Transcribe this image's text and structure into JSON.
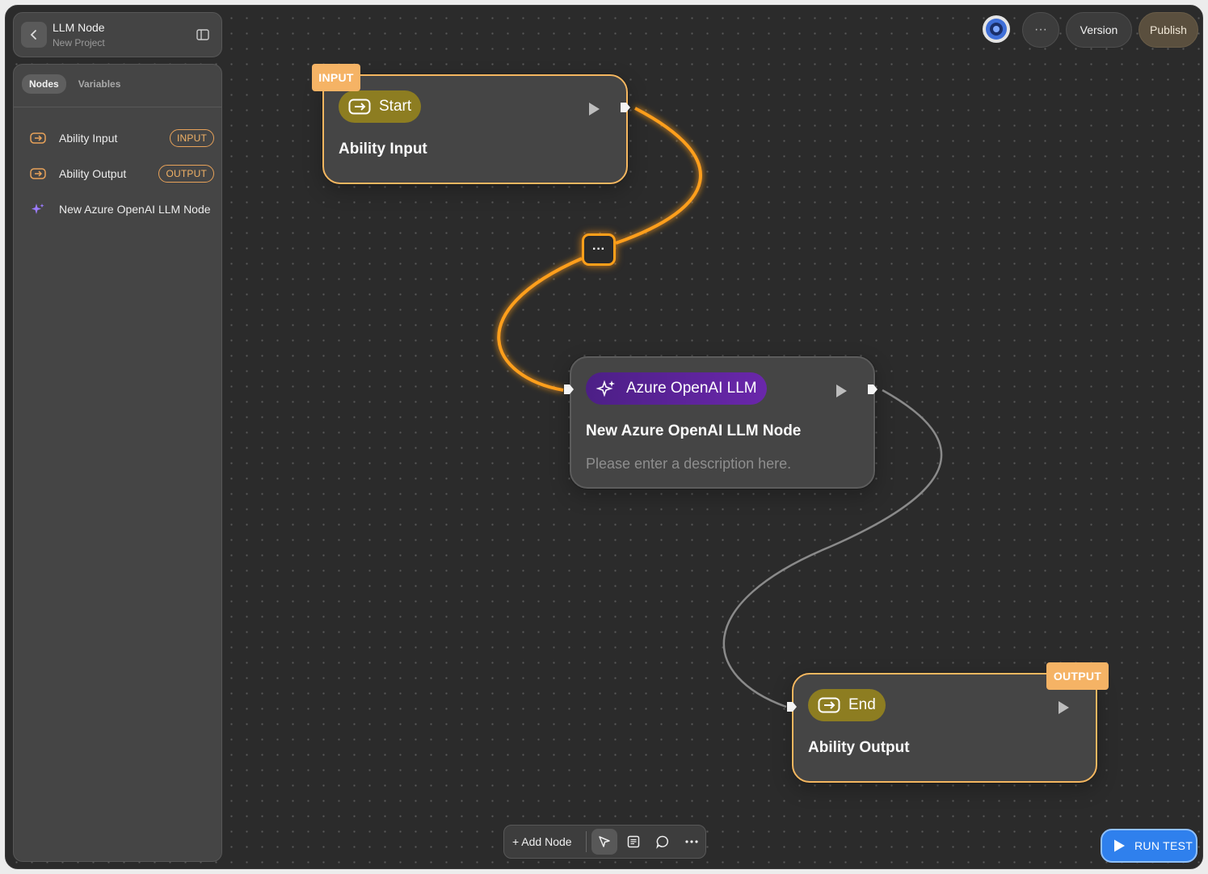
{
  "project": {
    "title": "LLM Node",
    "subtitle": "New Project"
  },
  "sidebar": {
    "tabs": [
      {
        "label": "Nodes",
        "active": true
      },
      {
        "label": "Variables",
        "active": false
      }
    ],
    "items": [
      {
        "label": "Ability Input",
        "badge": "INPUT",
        "icon": "arrow-box-icon"
      },
      {
        "label": "Ability Output",
        "badge": "OUTPUT",
        "icon": "arrow-box-icon"
      },
      {
        "label": "New Azure OpenAI LLM Node",
        "badge": "",
        "icon": "sparkle-icon"
      }
    ]
  },
  "header": {
    "more_label": "···",
    "version_label": "Version",
    "publish_label": "Publish"
  },
  "nodes": {
    "start": {
      "tag": "INPUT",
      "chip": "Start",
      "title": "Ability Input"
    },
    "llm": {
      "chip": "Azure OpenAI LLM",
      "title": "New Azure OpenAI LLM Node",
      "description": "Please enter a description here."
    },
    "end": {
      "tag": "OUTPUT",
      "chip": "End",
      "title": "Ability Output"
    }
  },
  "edge_menu": {
    "label": "···"
  },
  "toolbar": {
    "add_node_label": "+ Add Node"
  },
  "run_test": {
    "label": "RUN TEST"
  },
  "colors": {
    "accent": "#f5b760",
    "edge_active": "#ff9f1a",
    "edge_idle": "#8a8a8a",
    "run_test": "#2f80ed",
    "llm_chip": "#5a23a0",
    "start_chip": "#8d7d21"
  }
}
